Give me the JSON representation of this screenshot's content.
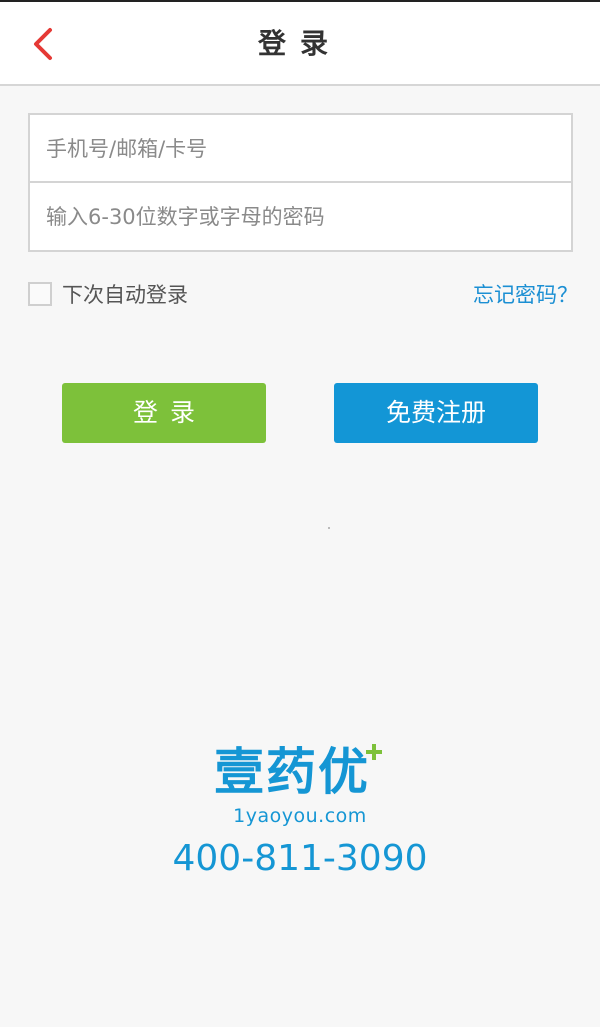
{
  "header": {
    "title": "登录",
    "back_icon": "chevron-left-icon",
    "back_color": "#e53935"
  },
  "form": {
    "account_placeholder": "手机号/邮箱/卡号",
    "account_value": "",
    "password_placeholder": "输入6-30位数字或字母的密码",
    "password_value": ""
  },
  "options": {
    "remember_label": "下次自动登录",
    "remember_checked": false,
    "forgot_label": "忘记密码？"
  },
  "buttons": {
    "login_label": "登录",
    "register_label": "免费注册"
  },
  "brand": {
    "name": "壹药优",
    "domain": "1yaoyou.com",
    "phone": "400-811-3090"
  },
  "colors": {
    "login_green": "#7dc13a",
    "register_blue": "#1396d6",
    "brand_blue": "#1596d4",
    "link_blue": "#1b8fd3"
  }
}
